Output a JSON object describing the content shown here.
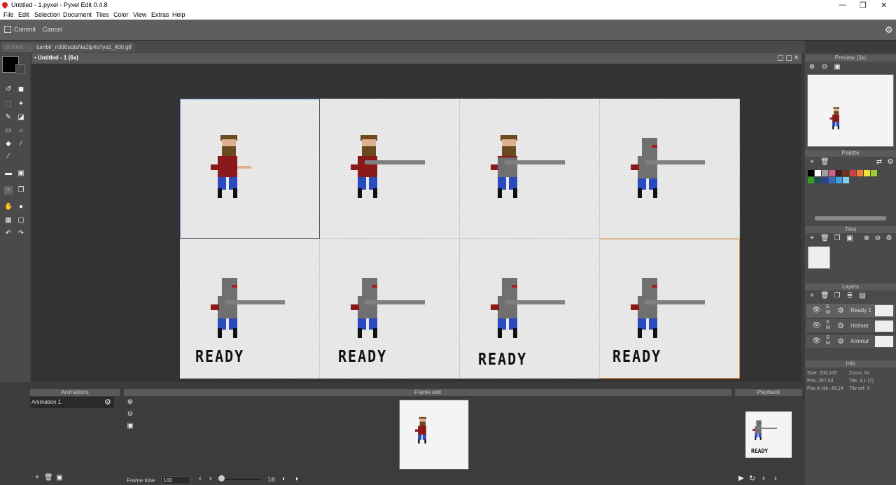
{
  "window": {
    "title": "Untitled - 1.pyxel - Pyxel Edit 0.4.8",
    "min": "—",
    "max": "❐",
    "close": "✕"
  },
  "menu": [
    "File",
    "Edit",
    "Selection",
    "Document",
    "Tiles",
    "Color",
    "View",
    "Extras",
    "Help"
  ],
  "toolbar": {
    "commit": "Commit",
    "cancel": "Cancel"
  },
  "tabs": {
    "tab1": "Untitled - ...",
    "tab2": "tumblr_n390uqtsNa1tp4o7yo1_400.gif"
  },
  "doc": {
    "title": "• Untitled - 1   (6x)"
  },
  "sheet": {
    "ready": [
      "READY",
      "READY",
      "READY",
      "READY"
    ]
  },
  "right": {
    "preview": "Preview (3x)",
    "palette": "Palette",
    "tiles": "Tiles",
    "layers": "Layers",
    "layer_list": [
      "Ready 1",
      "Helmet",
      "Armour"
    ],
    "info": "Info",
    "info_rows": [
      [
        "Size: 200,100",
        "Zoom: 6x"
      ],
      [
        "Pos: 207,53",
        "Tile: 3,1 (7)"
      ],
      [
        "Pos in tile: 49,14",
        "Tile ref: X"
      ]
    ],
    "palette_colors": [
      "#000000",
      "#ffffff",
      "#a0a0a0",
      "#d06080",
      "#402020",
      "#703020",
      "#d04040",
      "#f08030",
      "#f0e040",
      "#a0d030",
      "#30a020",
      "#205050",
      "#304090",
      "#3070c0",
      "#40a0e0",
      "#80d0f0"
    ]
  },
  "bottom": {
    "animations": "Animations",
    "anim1": "Animation 1",
    "frame_edit": "Frame edit",
    "playback": "Playback",
    "frame_time_label": "Frame time",
    "frame_time_value": "100",
    "frame_count": "1/8",
    "ready_small": "READY"
  }
}
